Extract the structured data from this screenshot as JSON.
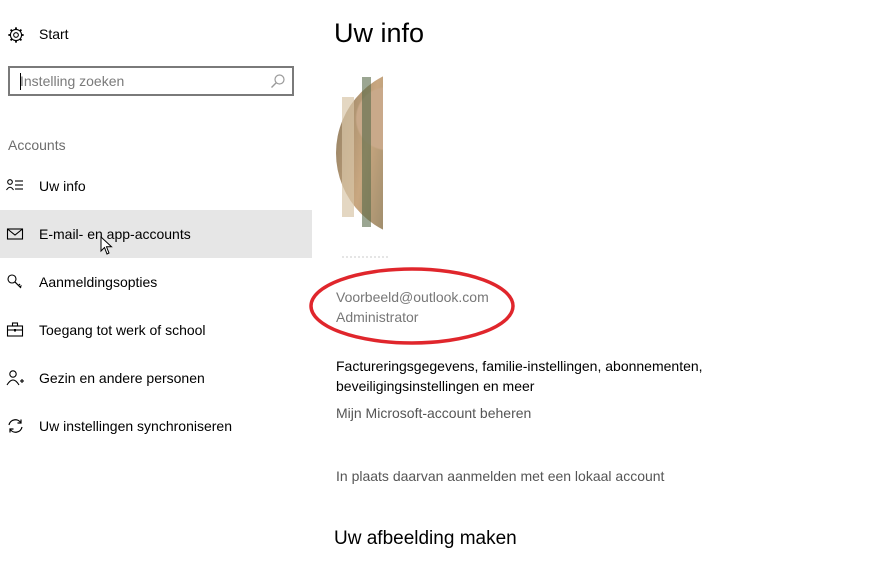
{
  "sidebar": {
    "start_label": "Start",
    "search": {
      "placeholder": "Instelling zoeken"
    },
    "group_title": "Accounts",
    "items": [
      {
        "label": "Uw info",
        "icon": "person-card-icon"
      },
      {
        "label": "E-mail- en app-accounts",
        "icon": "mail-icon",
        "selected": true
      },
      {
        "label": "Aanmeldingsopties",
        "icon": "key-icon"
      },
      {
        "label": "Toegang tot werk of school",
        "icon": "briefcase-icon"
      },
      {
        "label": "Gezin en andere personen",
        "icon": "person-add-icon"
      },
      {
        "label": "Uw instellingen synchroniseren",
        "icon": "sync-icon"
      }
    ]
  },
  "main": {
    "title": "Uw info",
    "email": "Voorbeeld@outlook.com",
    "role": "Administrator",
    "description": "Factureringsgegevens, familie-instellingen, abonnementen, beveiligingsinstellingen en meer",
    "manage_link": "Mijn Microsoft-account beheren",
    "local_account_link": "In plaats daarvan aanmelden met een lokaal account",
    "section_title": "Uw afbeelding maken"
  },
  "colors": {
    "selected_bg": "#e6e6e6",
    "annotation": "#e0262c",
    "secondary_text": "#777777"
  }
}
